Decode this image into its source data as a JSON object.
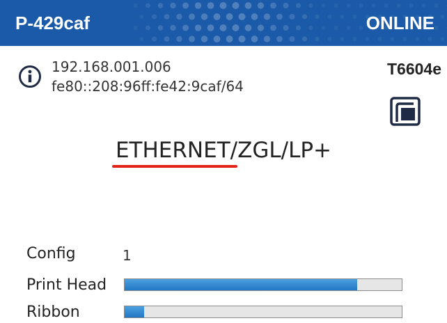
{
  "header": {
    "printer_name": "P-429caf",
    "status": "ONLINE",
    "background": "#1a5aa8"
  },
  "network": {
    "ipv4": "192.168.001.006",
    "ipv6": "fe80::208:96ff:fe42:9caf/64",
    "icon": "info-icon"
  },
  "model": "T6604e",
  "copy_icon": "copy-icon",
  "protocol": {
    "active": "ETHERNET",
    "rest": "/ZGL/LP+",
    "underline_color": "#e2231a"
  },
  "config": {
    "label": "Config",
    "value": "1"
  },
  "print_head": {
    "label": "Print Head",
    "level_percent": 84
  },
  "ribbon": {
    "label": "Ribbon",
    "level_percent": 7
  }
}
